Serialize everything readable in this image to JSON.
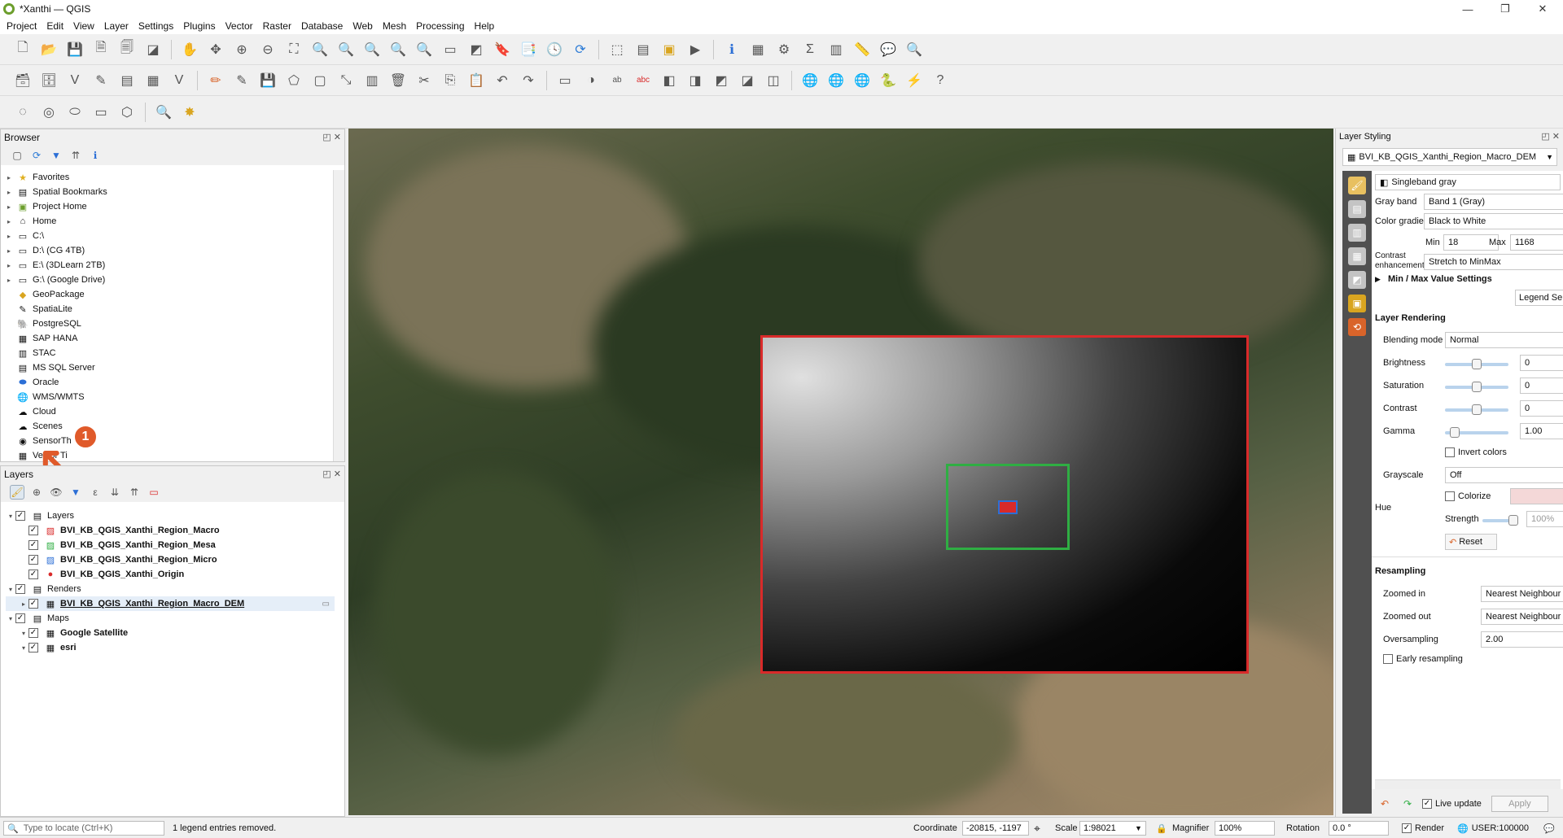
{
  "window": {
    "title": "*Xanthi — QGIS"
  },
  "menu": [
    "Project",
    "Edit",
    "View",
    "Layer",
    "Settings",
    "Plugins",
    "Vector",
    "Raster",
    "Database",
    "Web",
    "Mesh",
    "Processing",
    "Help"
  ],
  "browser": {
    "title": "Browser",
    "items": [
      "Favorites",
      "Spatial Bookmarks",
      "Project Home",
      "Home",
      "C:\\",
      "D:\\ (CG 4TB)",
      "E:\\ (3DLearn 2TB)",
      "G:\\ (Google Drive)",
      "GeoPackage",
      "SpatiaLite",
      "PostgreSQL",
      "SAP HANA",
      "STAC",
      "MS SQL Server",
      "Oracle",
      "WMS/WMTS",
      "Cloud",
      "Scenes",
      "SensorTh",
      "Vector Ti"
    ]
  },
  "layers": {
    "title": "Layers",
    "groups": [
      {
        "name": "Layers",
        "items": [
          "BVI_KB_QGIS_Xanthi_Region_Macro",
          "BVI_KB_QGIS_Xanthi_Region_Mesa",
          "BVI_KB_QGIS_Xanthi_Region_Micro",
          "BVI_KB_QGIS_Xanthi_Origin"
        ]
      },
      {
        "name": "Renders",
        "items": [
          "BVI_KB_QGIS_Xanthi_Region_Macro_DEM"
        ]
      },
      {
        "name": "Maps",
        "items": [
          "Google Satellite",
          "esri"
        ]
      }
    ]
  },
  "annotation": {
    "number": "1"
  },
  "styling": {
    "title": "Layer Styling",
    "layer": "BVI_KB_QGIS_Xanthi_Region_Macro_DEM",
    "renderer": "Singleband gray",
    "gray_band_label": "Gray band",
    "gray_band": "Band 1 (Gray)",
    "color_gradient_label": "Color gradient",
    "color_gradient": "Black to White",
    "min_label": "Min",
    "min": "18",
    "max_label": "Max",
    "max": "1168",
    "contrast_label_1": "Contrast",
    "contrast_label_2": "enhancement",
    "contrast": "Stretch to MinMax",
    "minmax_settings": "Min / Max Value Settings",
    "legend_button": "Legend Se",
    "layer_rendering": "Layer Rendering",
    "blending_label": "Blending mode",
    "blending": "Normal",
    "brightness_label": "Brightness",
    "brightness": "0",
    "saturation_label": "Saturation",
    "saturation": "0",
    "contrast2_label": "Contrast",
    "contrast2": "0",
    "gamma_label": "Gamma",
    "gamma": "1.00",
    "invert_label": "Invert colors",
    "grayscale_label": "Grayscale",
    "grayscale": "Off",
    "colorize_label": "Colorize",
    "hue_label": "Hue",
    "strength_label": "Strength",
    "strength": "100%",
    "reset": "Reset",
    "resampling": "Resampling",
    "zoomed_in_label": "Zoomed in",
    "zoomed_in": "Nearest Neighbour",
    "zoomed_out_label": "Zoomed out",
    "zoomed_out": "Nearest Neighbour",
    "oversampling_label": "Oversampling",
    "oversampling": "2.00",
    "early_label": "Early resampling",
    "live_update": "Live update",
    "apply": "Apply"
  },
  "status": {
    "locate_placeholder": "Type to locate (Ctrl+K)",
    "message": "1 legend entries removed.",
    "coordinate_label": "Coordinate",
    "coordinate": "-20815, -1197",
    "scale_label": "Scale",
    "scale": "1:98021",
    "magnifier_label": "Magnifier",
    "magnifier": "100%",
    "rotation_label": "Rotation",
    "rotation": "0.0 °",
    "render_label": "Render",
    "crs": "USER:100000"
  }
}
